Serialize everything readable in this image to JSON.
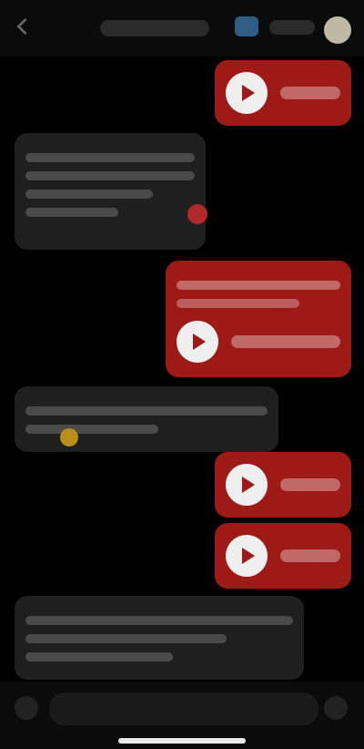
{
  "header": {
    "title": "",
    "back_icon": "chevron-left-icon",
    "avatar_icon": "avatar-circle"
  },
  "messages": [
    {
      "id": "m1",
      "type": "voice",
      "direction": "out"
    },
    {
      "id": "m2",
      "type": "text",
      "direction": "in",
      "text": ""
    },
    {
      "id": "m3",
      "type": "voice_with_text",
      "direction": "out"
    },
    {
      "id": "m4",
      "type": "text",
      "direction": "in",
      "text": ""
    },
    {
      "id": "m5",
      "type": "voice",
      "direction": "out"
    },
    {
      "id": "m6",
      "type": "voice",
      "direction": "out"
    },
    {
      "id": "m7",
      "type": "text",
      "direction": "in",
      "text": ""
    }
  ],
  "composer": {
    "placeholder": "",
    "plus_icon": "plus-icon",
    "mic_icon": "mic-icon"
  },
  "colors": {
    "background": "#000000",
    "outgoing_bubble": "#9e1a16",
    "incoming_bubble": "#1f1f1f",
    "accent_blue": "#2f5d85"
  }
}
